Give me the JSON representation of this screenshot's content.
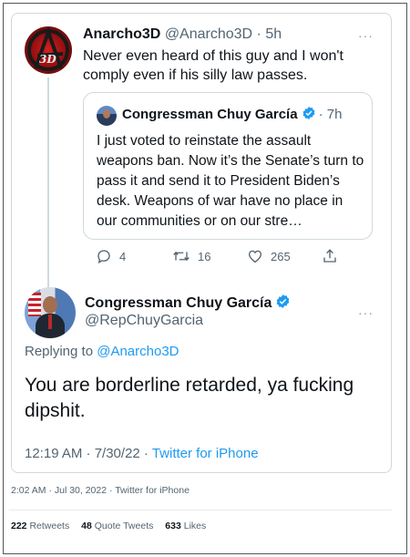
{
  "tweet1": {
    "name": "Anarcho3D",
    "handle": "@Anarcho3D",
    "time": "5h",
    "more": "···",
    "text": "Never even heard of this guy and I won't comply even if his silly law passes.",
    "avatar_text": "3D"
  },
  "quote": {
    "name": "Congressman Chuy García",
    "time": "7h",
    "text": "I just voted to reinstate the assault weapons ban. Now it’s the Senate’s turn to pass it and send it to President Biden’s desk. Weapons of war have no place in our communities or on our stre…"
  },
  "actions": {
    "replies": "4",
    "retweets": "16",
    "likes": "265"
  },
  "reply": {
    "name": "Congressman Chuy García",
    "handle": "@RepChuyGarcia",
    "more": "···",
    "replying_prefix": "Replying to",
    "replying_to": "@Anarcho3D",
    "text": "You are borderline retarded, ya fucking dipshit.",
    "timestamp": "12:19 AM · 7/30/22 ·",
    "source": "Twitter for iPhone"
  },
  "outer": {
    "timestamp": "2:02 AM · Jul 30, 2022 · Twitter for iPhone",
    "retweets_count": "222",
    "retweets_label": "Retweets",
    "quotes_count": "48",
    "quotes_label": "Quote Tweets",
    "likes_count": "633",
    "likes_label": "Likes"
  },
  "colors": {
    "link": "#1d9bf0",
    "secondary_text": "#536471",
    "verified": "#1d9bf0"
  }
}
